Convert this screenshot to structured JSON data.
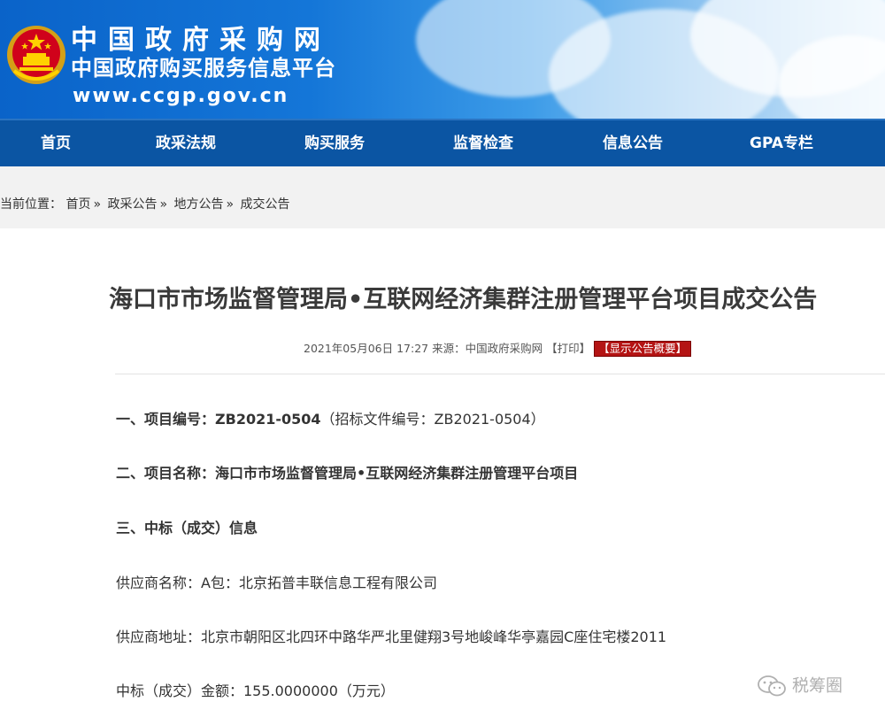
{
  "header": {
    "site_name": "中国政府采购网",
    "site_subtitle": "中国政府购买服务信息平台",
    "site_url": "www.ccgp.gov.cn"
  },
  "nav": {
    "items": [
      "首页",
      "政采法规",
      "购买服务",
      "监督检查",
      "信息公告",
      "GPA专栏"
    ]
  },
  "breadcrumb": {
    "prefix": "当前位置：",
    "items": [
      "首页",
      "政采公告",
      "地方公告",
      "成交公告"
    ],
    "separator": "»"
  },
  "article": {
    "title": "海口市市场监督管理局•互联网经济集群注册管理平台项目成交公告",
    "meta_date": "2021年05月06日 17:27",
    "meta_source": "来源：中国政府采购网",
    "print_label": "【打印】",
    "summary_label": "【显示公告概要】",
    "sections": {
      "item1_label": "一、项目编号：",
      "item1_value": "ZB2021-0504",
      "item1_note": "（招标文件编号：ZB2021-0504）",
      "item2_label": "二、项目名称：",
      "item2_value": "海口市市场监督管理局•互联网经济集群注册管理平台项目",
      "item3_label": "三、中标（成交）信息",
      "supplier_name": "供应商名称：A包：北京拓普丰联信息工程有限公司",
      "supplier_address": "供应商地址：北京市朝阳区北四环中路华严北里健翔3号地峻峰华亭嘉园C座住宅楼2011",
      "amount": "中标（成交）金额：155.0000000（万元）"
    }
  },
  "watermark": {
    "text": "税筹圈",
    "icon": "wechat-icon"
  },
  "colors": {
    "nav_bg": "#0b55a3",
    "banner_blue": "#1476d8",
    "summary_red": "#b41414"
  }
}
